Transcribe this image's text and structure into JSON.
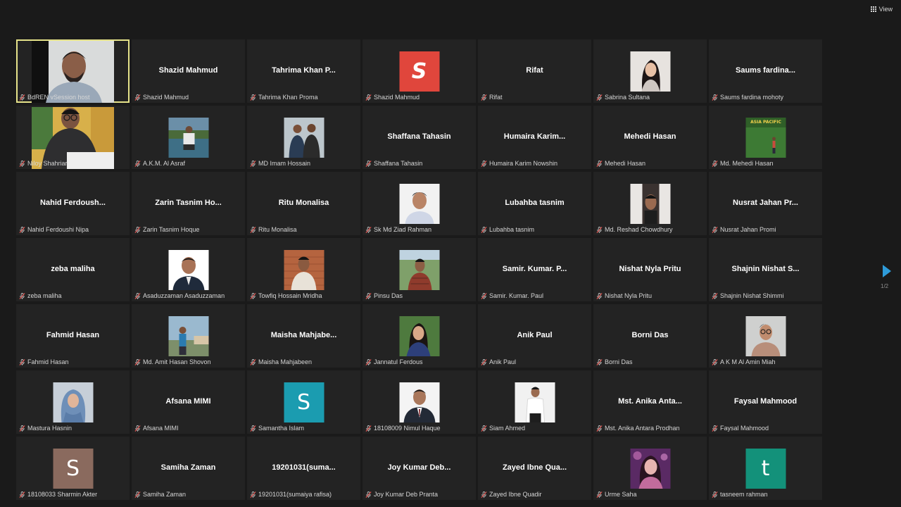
{
  "toolbar": {
    "view_label": "View"
  },
  "pager": {
    "indicator": "1/2"
  },
  "colors": {
    "tile_bg": "#232323",
    "app_bg": "#1a1a1a",
    "host_border": "#e6e38a",
    "arrow": "#2e9bd9",
    "mic_muted": "#d9534f"
  },
  "tiles": [
    {
      "name": "BdREN vSession host",
      "display": "",
      "kind": "video",
      "video": "host",
      "host": true
    },
    {
      "name": "Shazid Mahmud",
      "display": "Shazid Mahmud",
      "kind": "name"
    },
    {
      "name": "Tahrima Khan Proma",
      "display": "Tahrima  Khan  P...",
      "kind": "name"
    },
    {
      "name": "Shazid Mahmud",
      "display": "",
      "kind": "letter",
      "letter": "S",
      "color": "#e0463c",
      "style": "italic"
    },
    {
      "name": "Rifat",
      "display": "Rifat",
      "kind": "name"
    },
    {
      "name": "Sabrina Sultana",
      "display": "",
      "kind": "photo",
      "photo": "woman-light"
    },
    {
      "name": "Saums fardina mohoty",
      "display": "Saums  fardina...",
      "kind": "name"
    },
    {
      "name": "Niloy Shahriar",
      "display": "",
      "kind": "video",
      "video": "niloy"
    },
    {
      "name": "A.K.M. Al Asraf",
      "display": "",
      "kind": "photo",
      "photo": "outdoor-lake"
    },
    {
      "name": "MD Imam Hossain",
      "display": "",
      "kind": "photo",
      "photo": "two-men"
    },
    {
      "name": "Shaffana Tahasin",
      "display": "Shaffana Tahasin",
      "kind": "name"
    },
    {
      "name": "Humaira Karim Nowshin",
      "display": "Humaira  Karim...",
      "kind": "name"
    },
    {
      "name": "Mehedi Hasan",
      "display": "Mehedi Hasan",
      "kind": "name"
    },
    {
      "name": "Md. Mehedi Hasan",
      "display": "",
      "kind": "photo",
      "photo": "asia-pacific",
      "caption": "ASIA PACIFIC"
    },
    {
      "name": "Nahid Ferdoushi  Nipa",
      "display": "Nahid  Ferdoush...",
      "kind": "name"
    },
    {
      "name": "Zarin Tasnim Hoque",
      "display": "Zarin  Tasnim  Ho...",
      "kind": "name"
    },
    {
      "name": "Ritu Monalisa",
      "display": "Ritu Monalisa",
      "kind": "name"
    },
    {
      "name": "Sk Md Ziad Rahman",
      "display": "",
      "kind": "photo",
      "photo": "man-white-bg"
    },
    {
      "name": "Lubahba tasnim",
      "display": "Lubahba tasnim",
      "kind": "name"
    },
    {
      "name": "Md. Reshad Chowdhury",
      "display": "",
      "kind": "photo",
      "photo": "man-dark"
    },
    {
      "name": "Nusrat Jahan Promi",
      "display": "Nusrat  Jahan  Pr...",
      "kind": "name"
    },
    {
      "name": "zeba maliha",
      "display": "zeba maliha",
      "kind": "name"
    },
    {
      "name": "Asaduzzaman Asaduzzaman",
      "display": "",
      "kind": "photo",
      "photo": "man-suit"
    },
    {
      "name": "Towfiq Hossain Mridha",
      "display": "",
      "kind": "photo",
      "photo": "man-brick"
    },
    {
      "name": "Pinsu Das",
      "display": "",
      "kind": "photo",
      "photo": "man-trees"
    },
    {
      "name": "Samir. Kumar. Paul",
      "display": "Samir.  Kumar.  P...",
      "kind": "name"
    },
    {
      "name": "Nishat Nyla Pritu",
      "display": "Nishat Nyla Pritu",
      "kind": "name"
    },
    {
      "name": "Shajnin Nishat Shimmi",
      "display": "Shajnin  Nishat  S...",
      "kind": "name"
    },
    {
      "name": "Fahmid Hasan",
      "display": "Fahmid Hasan",
      "kind": "name"
    },
    {
      "name": "Md. Amit Hasan Shovon",
      "display": "",
      "kind": "photo",
      "photo": "man-outdoor"
    },
    {
      "name": "Maisha Mahjabeen",
      "display": "Maisha  Mahjabe...",
      "kind": "name"
    },
    {
      "name": "Jannatul Ferdous",
      "display": "",
      "kind": "photo",
      "photo": "woman-green"
    },
    {
      "name": "Anik Paul",
      "display": "Anik Paul",
      "kind": "name"
    },
    {
      "name": "Borni Das",
      "display": "Borni Das",
      "kind": "name"
    },
    {
      "name": "A K M Al Amin Miah",
      "display": "",
      "kind": "photo",
      "photo": "man-glasses"
    },
    {
      "name": "Mastura Hasnin",
      "display": "",
      "kind": "photo",
      "photo": "woman-hijab"
    },
    {
      "name": "Afsana MIMI",
      "display": "Afsana MIMI",
      "kind": "name"
    },
    {
      "name": "Samantha Islam",
      "display": "",
      "kind": "letter",
      "letter": "S",
      "color": "#1b9cb0"
    },
    {
      "name": "18108009 Nimul Haque",
      "display": "",
      "kind": "photo",
      "photo": "man-suit2"
    },
    {
      "name": "Siam Ahmed",
      "display": "",
      "kind": "photo",
      "photo": "man-white-shirt"
    },
    {
      "name": "Mst. Anika Antara Prodhan",
      "display": "Mst.  Anika  Anta...",
      "kind": "name"
    },
    {
      "name": "Faysal Mahmood",
      "display": "Faysal Mahmood",
      "kind": "name"
    },
    {
      "name": "18108033 Sharmin Akter",
      "display": "",
      "kind": "letter",
      "letter": "S",
      "color": "#8a6a5e"
    },
    {
      "name": "Samiha Zaman",
      "display": "Samiha Zaman",
      "kind": "name"
    },
    {
      "name": "19201031(sumaiya rafisa)",
      "display": "19201031(suma...",
      "kind": "name"
    },
    {
      "name": "Joy Kumar Deb Pranta",
      "display": "Joy  Kumar  Deb...",
      "kind": "name"
    },
    {
      "name": "Zayed Ibne Quadir",
      "display": "Zayed  Ibne  Qua...",
      "kind": "name"
    },
    {
      "name": "Urme Saha",
      "display": "",
      "kind": "photo",
      "photo": "woman-pink"
    },
    {
      "name": "tasneem rahman",
      "display": "",
      "kind": "letter",
      "letter": "t",
      "color": "#13917a"
    }
  ]
}
